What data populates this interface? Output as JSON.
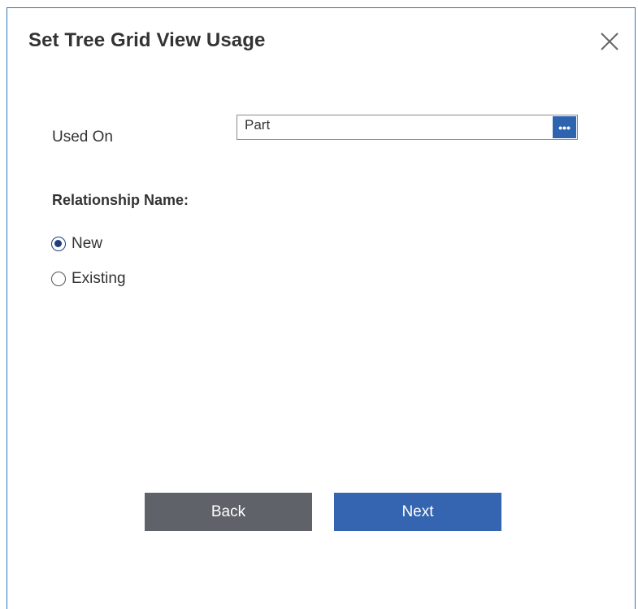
{
  "dialog": {
    "title": "Set Tree Grid View Usage",
    "close_icon": "close-icon"
  },
  "used_on": {
    "label": "Used On",
    "value": "Part",
    "browse_label": "•••"
  },
  "relationship": {
    "label": "Relationship Name:",
    "options": [
      {
        "label": "New",
        "selected": true
      },
      {
        "label": "Existing",
        "selected": false
      }
    ]
  },
  "buttons": {
    "back_label": "Back",
    "next_label": "Next"
  },
  "colors": {
    "primary": "#3565b0",
    "secondary": "#5f6268",
    "border": "#2e75b6"
  }
}
